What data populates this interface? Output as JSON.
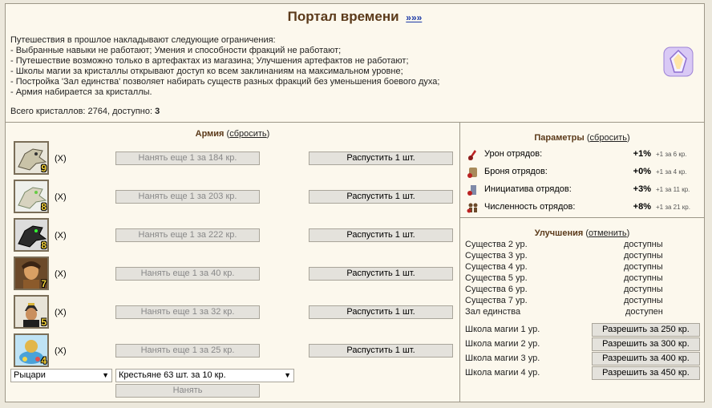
{
  "header": {
    "title": "Портал времени",
    "more_link": "»»»"
  },
  "rules": {
    "intro": "Путешествия в прошлое накладывают следующие ограничения:",
    "items": [
      "- Выбранные навыки не работают; Умения и способности фракций не работают;",
      "- Путешествие возможно только в артефактах из магазина; Улучшения артефактов не работают;",
      "- Школы магии за кристаллы открывают доступ ко всем заклинаниям на максимальном уровне;",
      "- Постройка 'Зал единства' позволяет набирать существ разных фракций без уменьшения боевого духа;",
      "- Армия набирается за кристаллы."
    ]
  },
  "crystals": {
    "prefix": "Всего кристаллов: 2764, доступно:",
    "available": "3"
  },
  "army": {
    "title": "Армия",
    "reset_label": "сбросить",
    "remove_label": "(X)",
    "dismiss_label": "Распустить 1 шт.",
    "units": [
      {
        "level": "9",
        "hire_label": "Нанять еще 1 за 184 кр.",
        "color": "#c9c3a8"
      },
      {
        "level": "8",
        "hire_label": "Нанять еще 1 за 203 кр.",
        "color": "#d7d3bf"
      },
      {
        "level": "8",
        "hire_label": "Нанять еще 1 за 222 кр.",
        "color": "#2b2b2b"
      },
      {
        "level": "7",
        "hire_label": "Нанять еще 1 за 40 кр.",
        "color": "#b98a4d"
      },
      {
        "level": "5",
        "hire_label": "Нанять еще 1 за 32 кр.",
        "color": "#3b3024"
      },
      {
        "level": "4",
        "hire_label": "Нанять еще 1 за 25 кр.",
        "color": "#4aa2d8"
      }
    ],
    "faction_select": "Рыцари",
    "unit_select": "Крестьяне 63 шт. за 10 кр.",
    "hire_button": "Нанять"
  },
  "params": {
    "title": "Параметры",
    "reset_label": "сбросить",
    "rows": [
      {
        "icon": "damage-icon",
        "label": "Урон отрядов:",
        "value": "+1%",
        "cost": "+1 за 6 кр."
      },
      {
        "icon": "armor-icon",
        "label": "Броня отрядов:",
        "value": "+0%",
        "cost": "+1 за 4 кр."
      },
      {
        "icon": "initiative-icon",
        "label": "Инициатива отрядов:",
        "value": "+3%",
        "cost": "+1 за 11 кр."
      },
      {
        "icon": "headcount-icon",
        "label": "Численность отрядов:",
        "value": "+8%",
        "cost": "+1 за 21 кр."
      }
    ]
  },
  "upgrades": {
    "title": "Улучшения",
    "cancel_label": "отменить",
    "items": [
      {
        "name": "Существа 2 ур.",
        "status": "доступны"
      },
      {
        "name": "Существа 3 ур.",
        "status": "доступны"
      },
      {
        "name": "Существа 4 ур.",
        "status": "доступны"
      },
      {
        "name": "Существа 5 ур.",
        "status": "доступны"
      },
      {
        "name": "Существа 6 ур.",
        "status": "доступны"
      },
      {
        "name": "Существа 7 ур.",
        "status": "доступны"
      },
      {
        "name": "Зал единства",
        "status": "доступен"
      }
    ],
    "schools": [
      {
        "name": "Школа магии 1 ур.",
        "button": "Разрешить за 250 кр."
      },
      {
        "name": "Школа магии 2 ур.",
        "button": "Разрешить за 300 кр."
      },
      {
        "name": "Школа магии 3 ур.",
        "button": "Разрешить за 400 кр."
      },
      {
        "name": "Школа магии 4 ур.",
        "button": "Разрешить за 450 кр."
      }
    ]
  }
}
